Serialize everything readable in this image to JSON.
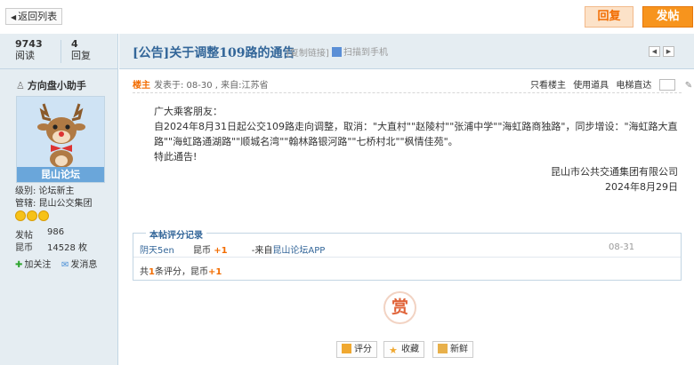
{
  "topbar": {
    "back_label": "返回列表",
    "reply_label": "回复",
    "post_label": "发帖"
  },
  "stats": {
    "views": "9743",
    "views_label": "阅读",
    "replies": "4",
    "replies_label": "回复"
  },
  "author": {
    "name": "方向盘小助手",
    "avatar_caption": "昆山论坛",
    "level": "级别: 论坛新主",
    "role": "管辖: 昆山公交集团",
    "posts_label": "发帖",
    "posts": "986",
    "coins_label": "昆币",
    "coins": "14528 枚",
    "follow": "加关注",
    "message": "发消息"
  },
  "thread": {
    "title": "[公告]关于调整109路的通告",
    "copy_link": "[复制链接]",
    "scan": "扫描到手机"
  },
  "post": {
    "badge": "楼主",
    "info": "发表于: 08-30 , 来自:江苏省",
    "tools": [
      "只看楼主",
      "使用道具",
      "电梯直达"
    ],
    "greeting": "广大乘客朋友：",
    "para1": "自2024年8月31日起公交109路走向调整，取消：\"大直村\"\"赵陵村\"\"张浦中学\"\"海虹路商独路\"，同步增设：\"海虹路大直路\"\"海虹路通湖路\"\"顺城名湾\"\"翰林路银河路\"\"七桥村北\"\"枫情佳苑\"。",
    "closing": "特此通告!",
    "org": "昆山市公共交通集团有限公司",
    "date": "2024年8月29日"
  },
  "rating": {
    "legend": "本帖评分记录",
    "user": "阴天5en",
    "field": "昆币",
    "points": "+1",
    "source_prefix": "-来自",
    "source_link": "昆山论坛APP",
    "date": "08-31",
    "summary_prefix": "共",
    "summary_count": "1",
    "summary_mid": "条评分，昆币",
    "summary_points": "+1"
  },
  "reward_label": "赏",
  "actions": {
    "rate": "评分",
    "favorite": "收藏",
    "fresh": "新鲜"
  },
  "colors": {
    "accent": "#336699",
    "orange": "#f26c00",
    "sidebar": "#e5edf2"
  }
}
